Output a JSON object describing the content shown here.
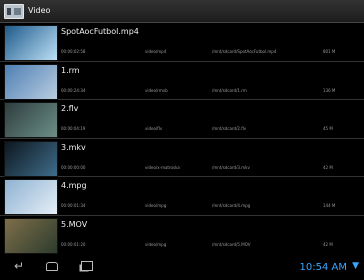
{
  "app": {
    "title": "Video",
    "icon": "video-app-icon"
  },
  "videos": [
    {
      "name": "SpotAocFutbol.mp4",
      "duration": "00:00:02:58",
      "type": "video/mp4",
      "path": "/mnt/sdcard/SpotAocFutbol.mp4",
      "size": "801 M",
      "thumb_colors": [
        "#1e5a8a",
        "#bde0f6"
      ]
    },
    {
      "name": "1.rm",
      "duration": "00:00:24:34",
      "type": "video/rmvb",
      "path": "/mnt/sdcard/1.rm",
      "size": "136 M",
      "thumb_colors": [
        "#4f7fb4",
        "#b8cde0"
      ]
    },
    {
      "name": "2.flv",
      "duration": "00:00:04:19",
      "type": "video/flv",
      "path": "/mnt/sdcard/2.flv",
      "size": "45 M",
      "thumb_colors": [
        "#2e3d3f",
        "#6c8f87"
      ]
    },
    {
      "name": "3.mkv",
      "duration": "00:00:00:00",
      "type": "video/x-matroska",
      "path": "/mnt/sdcard/3.mkv",
      "size": "42 M",
      "thumb_colors": [
        "#0d1720",
        "#3f6d8a"
      ]
    },
    {
      "name": "4.mpg",
      "duration": "00:00:01:34",
      "type": "video/mpg",
      "path": "/mnt/sdcard/4.mpg",
      "size": "144 M",
      "thumb_colors": [
        "#8fb2d2",
        "#e5eef6"
      ]
    },
    {
      "name": "5.MOV",
      "duration": "00:00:01:20",
      "type": "video/mpg",
      "path": "/mnt/sdcard/5.MOV",
      "size": "42 M",
      "thumb_colors": [
        "#7d6e4a",
        "#2d3c2d"
      ]
    }
  ],
  "status_bar": {
    "time": "10:54 AM",
    "wifi_icon": "wifi-icon"
  },
  "nav": {
    "back": "back-icon",
    "home": "home-icon",
    "recent": "recent-apps-icon"
  },
  "colors": {
    "accent": "#38a6ff",
    "background": "#000000"
  }
}
